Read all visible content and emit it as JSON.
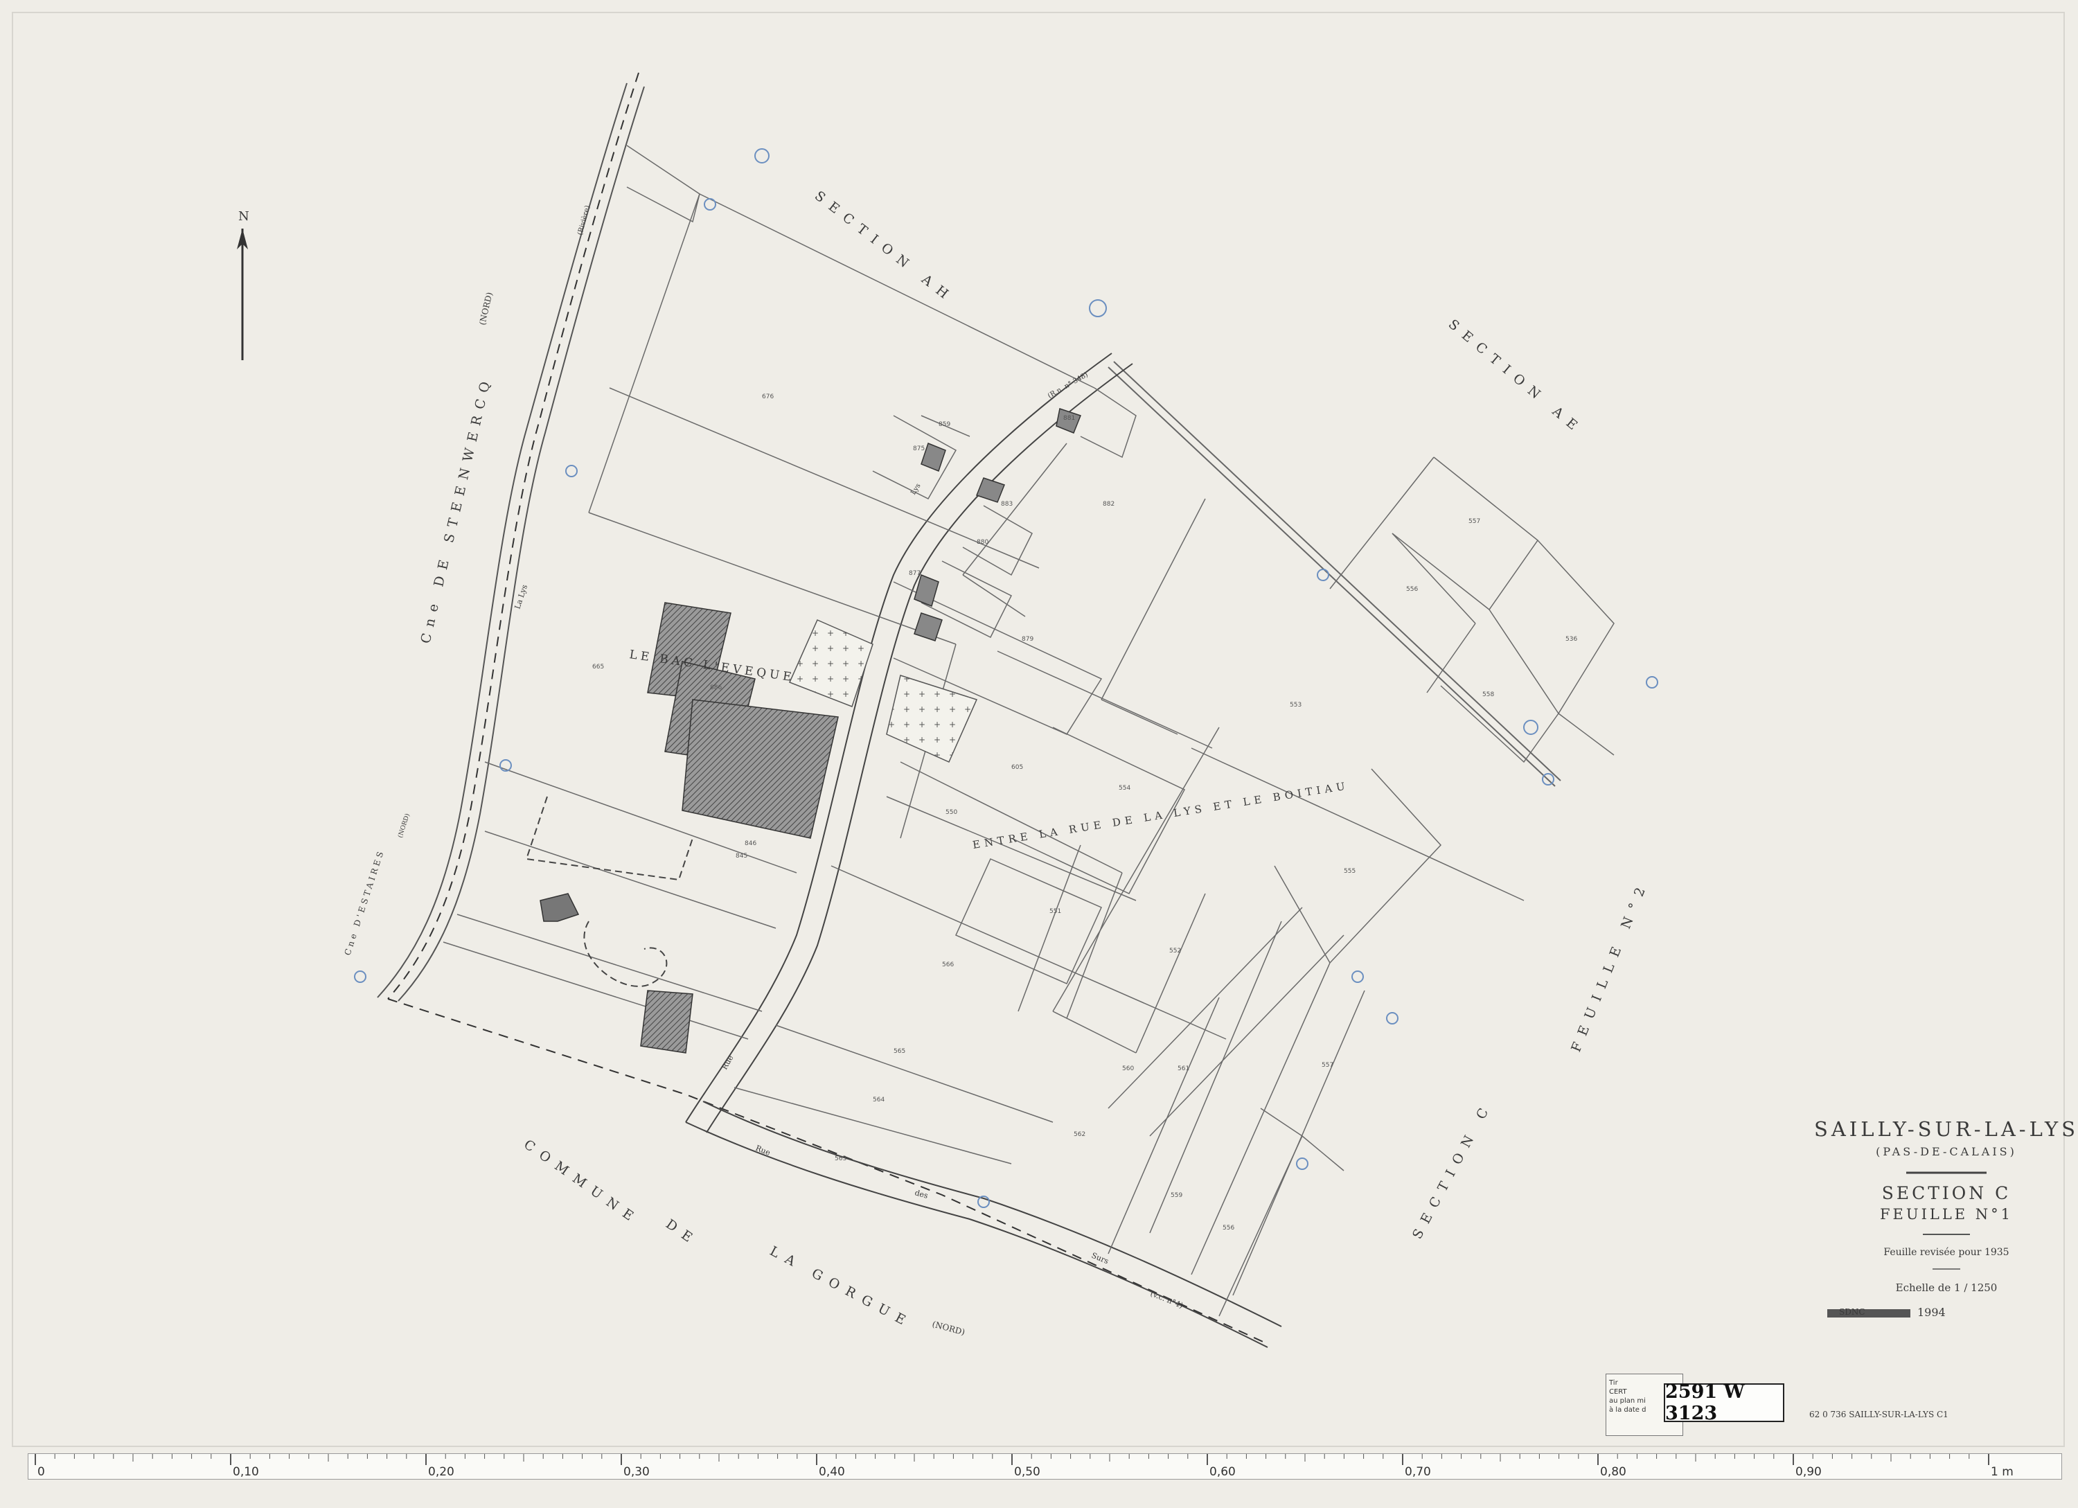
{
  "map": {
    "north_label": "N",
    "commune": "SAILLY-SUR-LA-LYS",
    "department": "(PAS-DE-CALAIS)",
    "section": "SECTION C",
    "sheet": "FEUILLE N°1",
    "revision": "Feuille revisée pour 1935",
    "scale": "Echelle de 1 / 1250",
    "stamp": "SDNC",
    "stamp_year": "1994",
    "archive_ref": "2591 W 3123",
    "footer_ref": "62 0 736  SAILLY-SUR-LA-LYS  C1",
    "certification_lines": [
      "Tir",
      "CERT",
      "au plan mi",
      "à la date d"
    ]
  },
  "labels": {
    "section_ah": "SECTION AH",
    "section_ae": "SECTION AE",
    "section_c": "SECTION C",
    "feuille_2": "FEUILLE N°2",
    "steenwercq": "Cne DE STEENWERCQ",
    "steenwercq_nord": "(NORD)",
    "estaires": "Cne D'ESTAIRES",
    "estaires_nord": "(NORD)",
    "commune_la_gorgue_1": "COMMUNE",
    "commune_la_gorgue_2": "DE",
    "commune_la_gorgue_3": "LA GORGUE",
    "la_gorgue_nord": "(NORD)",
    "le_bac_leveque": "LE BAC L'EVEQUE",
    "entre": "ENTRE LA RUE DE LA LYS ET LE BOITIAU",
    "la_lys_river": "La Lys",
    "riviere": "(Rivière)",
    "rn": "(R.n. n° 348)",
    "rue_de_la_lys": "Lys",
    "rue_des_surs_1": "Rue",
    "rue_des_surs_2": "des",
    "rue_des_surs_3": "Surs",
    "rue_des_surs_4": "(v.c. n°4)"
  },
  "parcels": [
    {
      "id": "676"
    },
    {
      "id": "859"
    },
    {
      "id": "875"
    },
    {
      "id": "881"
    },
    {
      "id": "882"
    },
    {
      "id": "883"
    },
    {
      "id": "877"
    },
    {
      "id": "879"
    },
    {
      "id": "880"
    },
    {
      "id": "557"
    },
    {
      "id": "556"
    },
    {
      "id": "558"
    },
    {
      "id": "536"
    },
    {
      "id": "553"
    },
    {
      "id": "555"
    },
    {
      "id": "554"
    },
    {
      "id": "550"
    },
    {
      "id": "551"
    },
    {
      "id": "552"
    },
    {
      "id": "665"
    },
    {
      "id": "886"
    },
    {
      "id": "605"
    },
    {
      "id": "560"
    },
    {
      "id": "561"
    },
    {
      "id": "559"
    },
    {
      "id": "556"
    },
    {
      "id": "557"
    },
    {
      "id": "566"
    },
    {
      "id": "565"
    },
    {
      "id": "564"
    },
    {
      "id": "563"
    },
    {
      "id": "562"
    },
    {
      "id": "846"
    },
    {
      "id": "845"
    }
  ],
  "ruler": {
    "big_marks": [
      "0",
      "0,10",
      "0,20",
      "0,30",
      "0,40",
      "0,50",
      "0,60",
      "0,70",
      "0,80",
      "0,90",
      "1 m"
    ]
  }
}
